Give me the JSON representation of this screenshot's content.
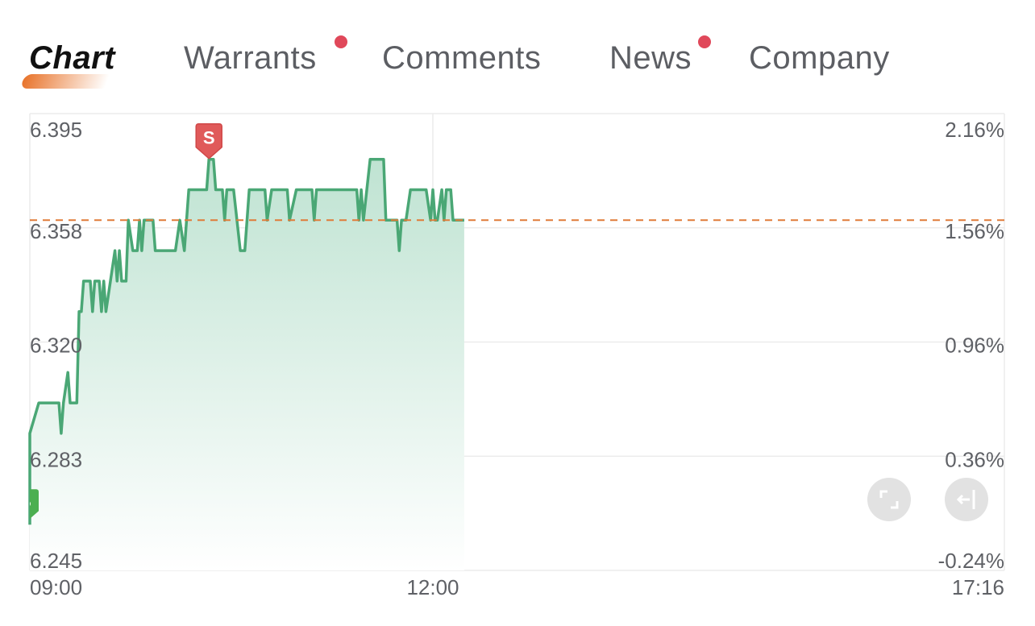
{
  "tabs": [
    {
      "label": "Chart",
      "active": true,
      "badge": false
    },
    {
      "label": "Warrants",
      "active": false,
      "badge": true
    },
    {
      "label": "Comments",
      "active": false,
      "badge": false
    },
    {
      "label": "News",
      "active": false,
      "badge": true
    },
    {
      "label": "Company",
      "active": false,
      "badge": false
    }
  ],
  "controls": {
    "fullscreen_icon": "fullscreen-icon",
    "collapse_icon": "arrow-left-bar-icon"
  },
  "colors": {
    "line": "#4aa775",
    "fill_top": "#bfe3d2",
    "current_price_line": "#e07b39",
    "sell_marker": "#e05a5a",
    "buy_marker": "#4caf50",
    "badge": "#e0485a"
  },
  "chart_data": {
    "type": "area",
    "title": "",
    "xlabel": "",
    "ylabel": "",
    "x_ticks": [
      "09:00",
      "12:00",
      "17:16"
    ],
    "y_ticks_left": [
      "6.395",
      "6.358",
      "6.320",
      "6.283",
      "6.245"
    ],
    "y_ticks_right": [
      "2.16%",
      "1.56%",
      "0.96%",
      "0.36%",
      "-0.24%"
    ],
    "ylim": [
      6.245,
      6.395
    ],
    "grid": true,
    "current_price_line": 6.36,
    "markers": [
      {
        "label": "B",
        "time": "09:00",
        "price": 6.26
      },
      {
        "label": "S",
        "time": "10:20",
        "price": 6.38
      }
    ],
    "series": [
      {
        "points": [
          [
            "09:00",
            6.26
          ],
          [
            "09:00",
            6.29
          ],
          [
            "09:04",
            6.3
          ],
          [
            "09:13",
            6.3
          ],
          [
            "09:14",
            6.29
          ],
          [
            "09:15",
            6.3
          ],
          [
            "09:17",
            6.31
          ],
          [
            "09:18",
            6.3
          ],
          [
            "09:21",
            6.3
          ],
          [
            "09:22",
            6.33
          ],
          [
            "09:23",
            6.33
          ],
          [
            "09:24",
            6.34
          ],
          [
            "09:27",
            6.34
          ],
          [
            "09:28",
            6.33
          ],
          [
            "09:29",
            6.34
          ],
          [
            "09:31",
            6.34
          ],
          [
            "09:32",
            6.33
          ],
          [
            "09:33",
            6.34
          ],
          [
            "09:34",
            6.33
          ],
          [
            "09:36",
            6.34
          ],
          [
            "09:38",
            6.35
          ],
          [
            "09:39",
            6.34
          ],
          [
            "09:40",
            6.35
          ],
          [
            "09:41",
            6.34
          ],
          [
            "09:43",
            6.34
          ],
          [
            "09:44",
            6.36
          ],
          [
            "09:46",
            6.35
          ],
          [
            "09:48",
            6.35
          ],
          [
            "09:49",
            6.36
          ],
          [
            "09:50",
            6.35
          ],
          [
            "09:51",
            6.36
          ],
          [
            "09:55",
            6.36
          ],
          [
            "09:56",
            6.35
          ],
          [
            "10:05",
            6.35
          ],
          [
            "10:07",
            6.36
          ],
          [
            "10:09",
            6.35
          ],
          [
            "10:11",
            6.37
          ],
          [
            "10:19",
            6.37
          ],
          [
            "10:20",
            6.38
          ],
          [
            "10:22",
            6.38
          ],
          [
            "10:23",
            6.37
          ],
          [
            "10:26",
            6.37
          ],
          [
            "10:27",
            6.36
          ],
          [
            "10:28",
            6.37
          ],
          [
            "10:31",
            6.37
          ],
          [
            "10:34",
            6.35
          ],
          [
            "10:36",
            6.35
          ],
          [
            "10:38",
            6.37
          ],
          [
            "10:45",
            6.37
          ],
          [
            "10:46",
            6.36
          ],
          [
            "10:48",
            6.37
          ],
          [
            "10:55",
            6.37
          ],
          [
            "10:56",
            6.36
          ],
          [
            "10:59",
            6.37
          ],
          [
            "11:06",
            6.37
          ],
          [
            "11:07",
            6.36
          ],
          [
            "11:08",
            6.37
          ],
          [
            "11:26",
            6.37
          ],
          [
            "11:27",
            6.36
          ],
          [
            "11:28",
            6.37
          ],
          [
            "11:29",
            6.36
          ],
          [
            "11:32",
            6.38
          ],
          [
            "11:38",
            6.38
          ],
          [
            "11:39",
            6.36
          ],
          [
            "11:44",
            6.36
          ],
          [
            "11:45",
            6.35
          ],
          [
            "11:46",
            6.36
          ],
          [
            "11:48",
            6.36
          ],
          [
            "11:50",
            6.37
          ],
          [
            "11:57",
            6.37
          ],
          [
            "11:59",
            6.36
          ],
          [
            "12:00",
            6.37
          ],
          [
            "12:01",
            6.36
          ],
          [
            "12:02",
            6.36
          ],
          [
            "12:04",
            6.37
          ],
          [
            "12:05",
            6.36
          ],
          [
            "12:06",
            6.37
          ],
          [
            "12:08",
            6.37
          ],
          [
            "12:09",
            6.36
          ],
          [
            "12:14",
            6.36
          ]
        ]
      }
    ]
  }
}
